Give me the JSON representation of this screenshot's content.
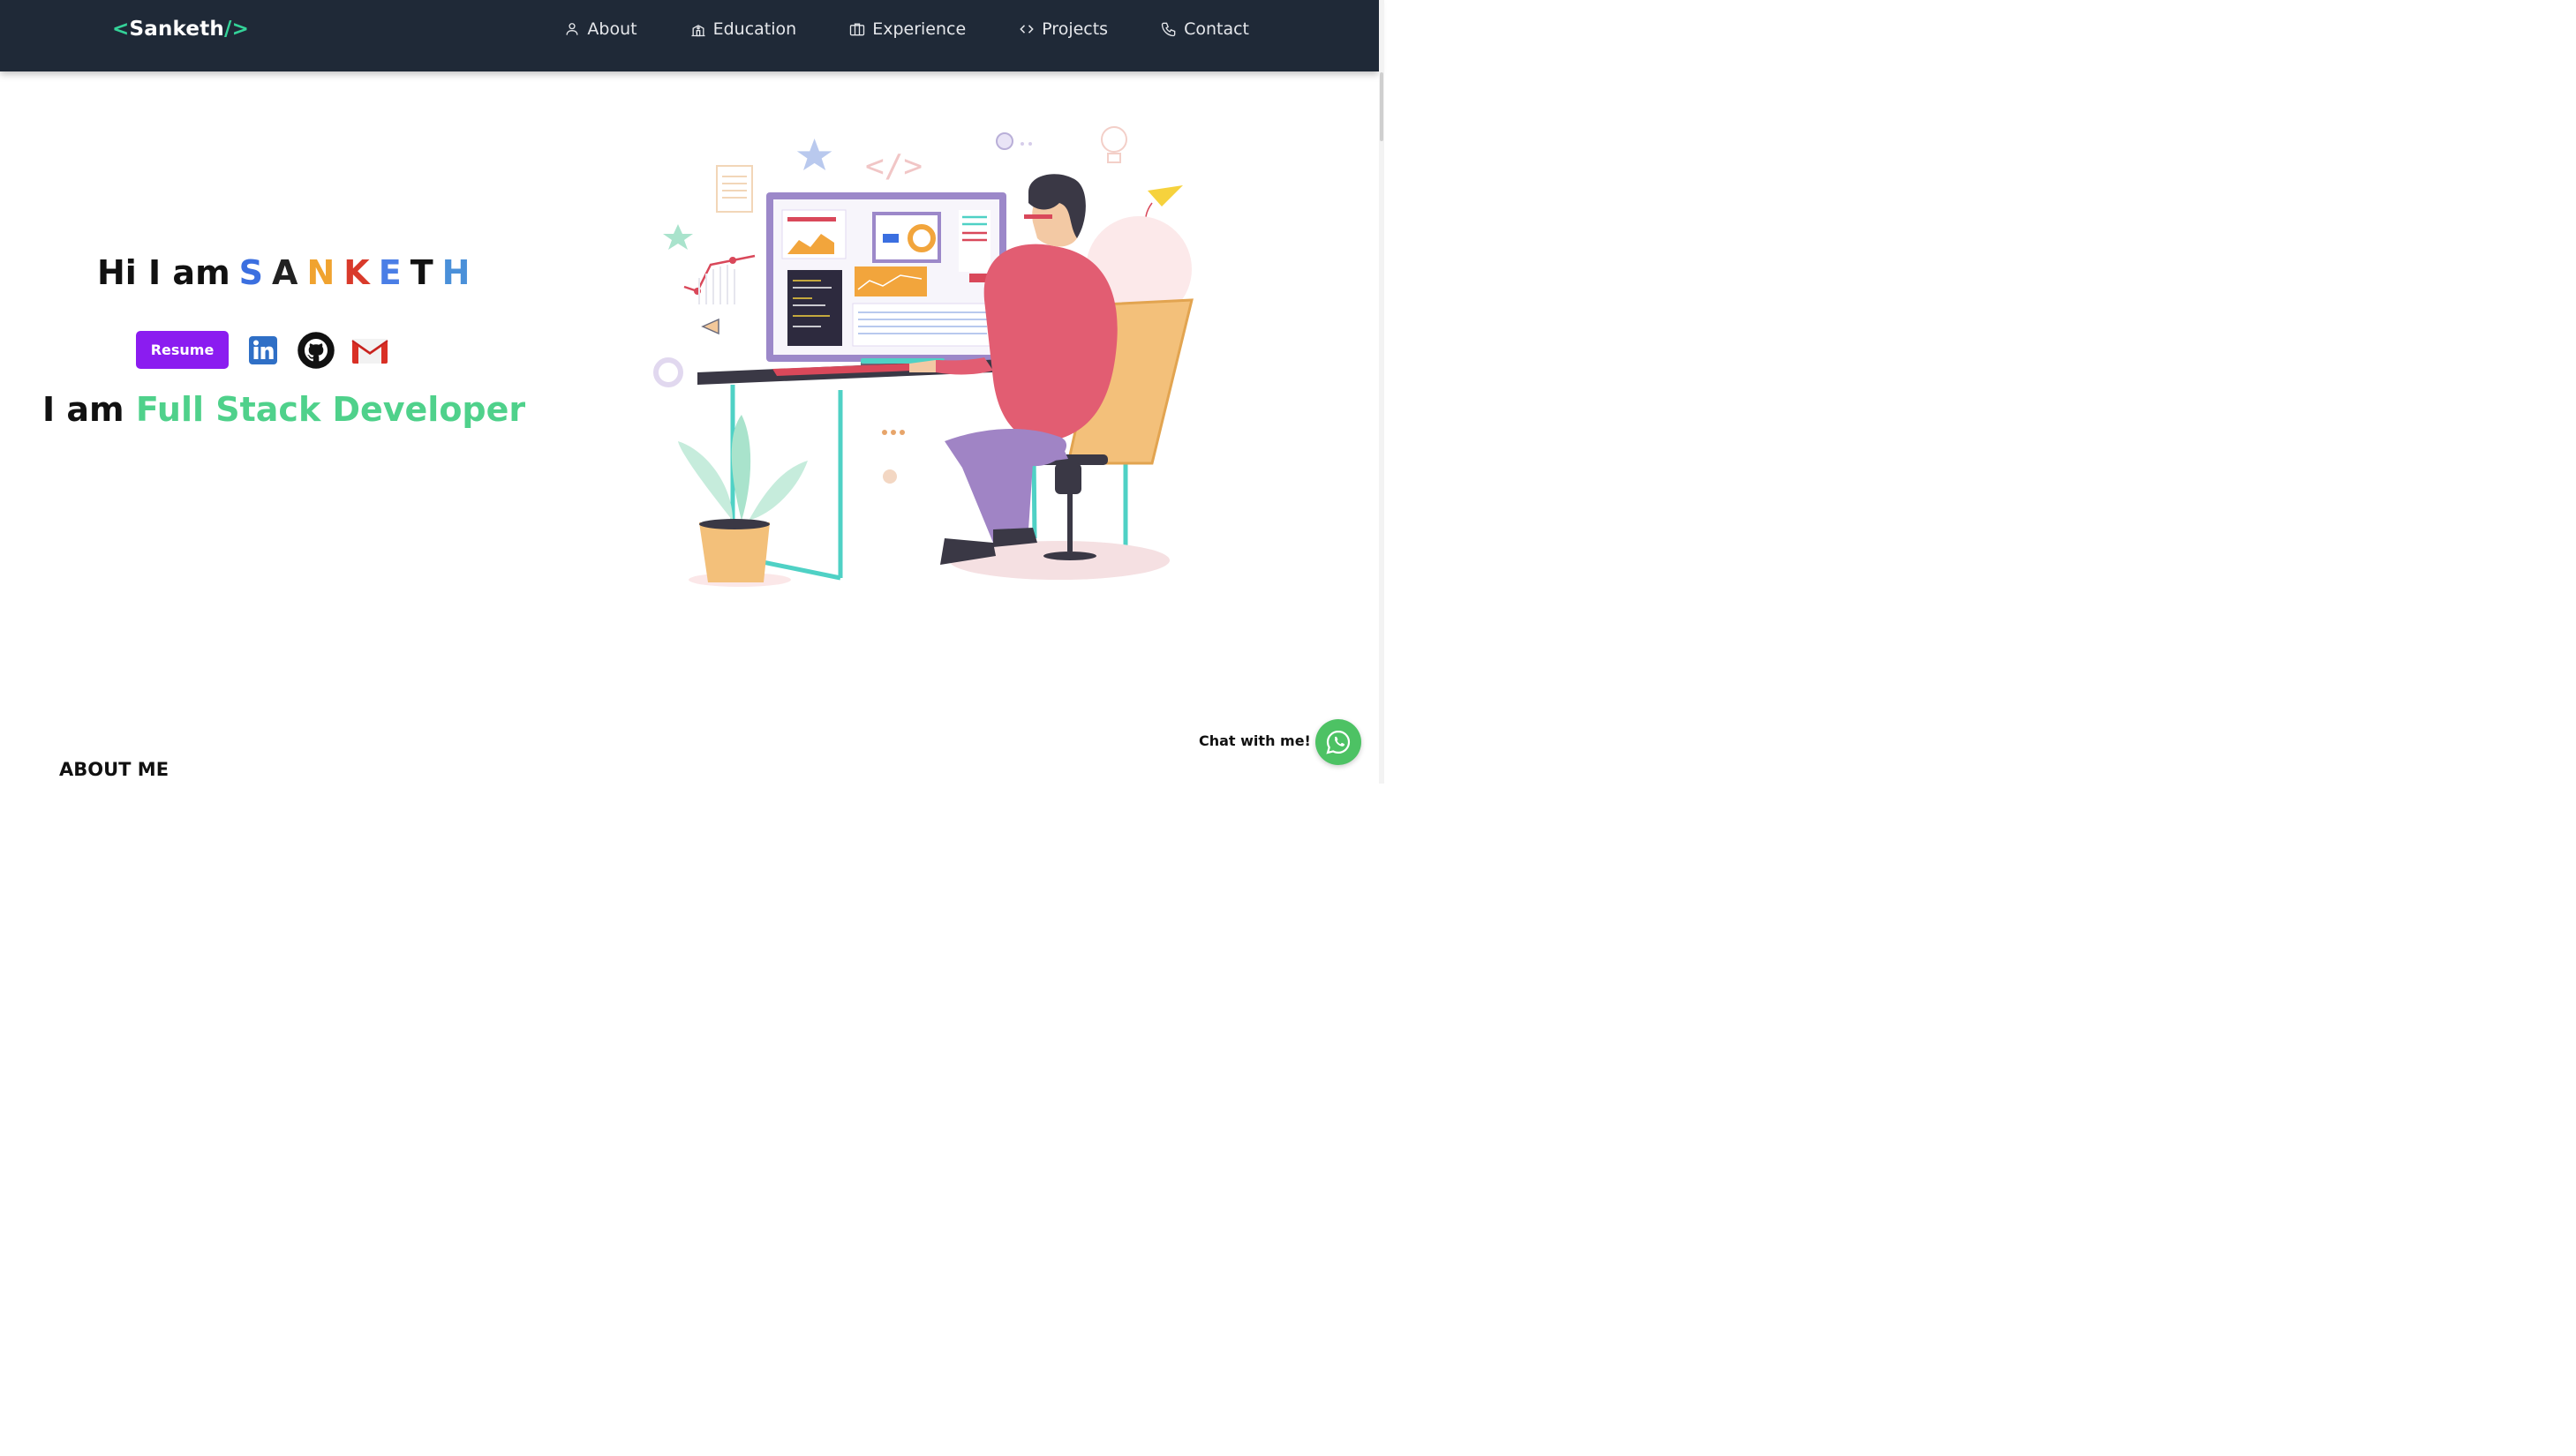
{
  "logo": {
    "open": "<",
    "name": "Sanketh",
    "close": "/>"
  },
  "nav": {
    "items": [
      {
        "label": "About",
        "icon": "user-icon"
      },
      {
        "label": "Education",
        "icon": "school-icon"
      },
      {
        "label": "Experience",
        "icon": "briefcase-icon"
      },
      {
        "label": "Projects",
        "icon": "code-icon"
      },
      {
        "label": "Contact",
        "icon": "phone-icon"
      }
    ]
  },
  "hero": {
    "greeting": "Hi I am",
    "name_letters": [
      {
        "ch": "S",
        "color": "#3b6fe0"
      },
      {
        "ch": "A",
        "color": "#222222"
      },
      {
        "ch": "N",
        "color": "#f0a32f"
      },
      {
        "ch": "K",
        "color": "#d93a2b"
      },
      {
        "ch": "E",
        "color": "#4a7ee6"
      },
      {
        "ch": "T",
        "color": "#111111"
      },
      {
        "ch": "H",
        "color": "#4a90d9"
      }
    ],
    "resume_label": "Resume",
    "role_prefix": "I am",
    "role": "Full Stack Developer"
  },
  "social": [
    {
      "name": "linkedin-icon",
      "color": "#2f6fc6"
    },
    {
      "name": "github-icon",
      "color": "#111111"
    },
    {
      "name": "gmail-icon",
      "color": "#d93025"
    }
  ],
  "chat": {
    "label": "Chat with me!"
  },
  "about": {
    "heading": "ABOUT ME"
  },
  "colors": {
    "nav_bg": "#1f2937",
    "accent_green": "#34d399",
    "resume_purple": "#8b1cf0",
    "whatsapp": "#4dc264"
  }
}
